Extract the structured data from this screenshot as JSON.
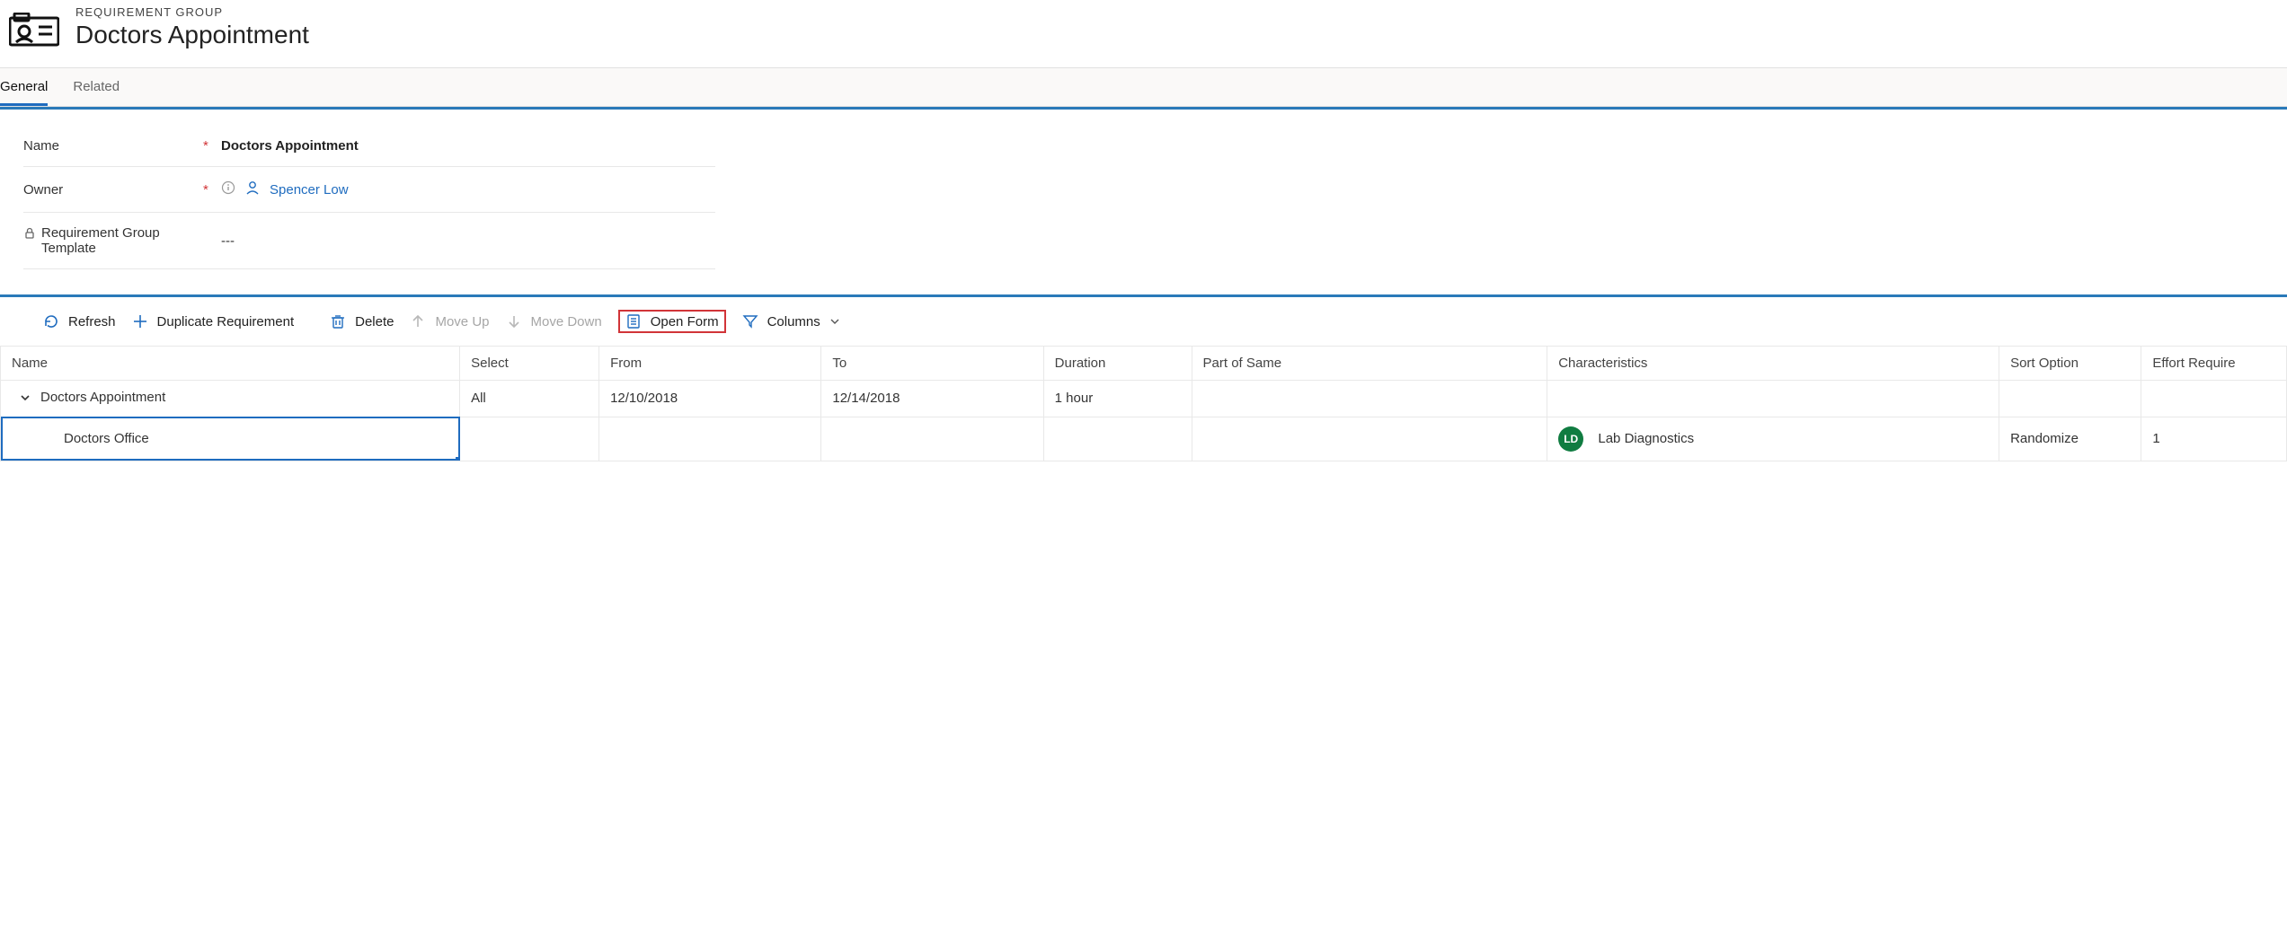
{
  "header": {
    "entity_type": "REQUIREMENT GROUP",
    "title": "Doctors Appointment"
  },
  "tabs": {
    "general": "General",
    "related": "Related"
  },
  "form": {
    "name_label": "Name",
    "name_value": "Doctors Appointment",
    "owner_label": "Owner",
    "owner_value": "Spencer Low",
    "template_label": "Requirement Group Template",
    "template_value": "---"
  },
  "toolbar": {
    "refresh": "Refresh",
    "duplicate": "Duplicate Requirement",
    "delete": "Delete",
    "move_up": "Move Up",
    "move_down": "Move Down",
    "open_form": "Open Form",
    "columns": "Columns"
  },
  "grid": {
    "headers": {
      "name": "Name",
      "select": "Select",
      "from": "From",
      "to": "To",
      "duration": "Duration",
      "part": "Part of Same",
      "characteristics": "Characteristics",
      "sort": "Sort Option",
      "effort": "Effort Require"
    },
    "rows": [
      {
        "name": "Doctors Appointment",
        "select": "All",
        "from": "12/10/2018",
        "to": "12/14/2018",
        "duration": "1 hour",
        "part": "",
        "characteristics": "",
        "char_badge": "",
        "sort": "",
        "effort": ""
      },
      {
        "name": "Doctors Office",
        "select": "",
        "from": "",
        "to": "",
        "duration": "",
        "part": "",
        "characteristics": "Lab Diagnostics",
        "char_badge": "LD",
        "sort": "Randomize",
        "effort": "1"
      }
    ]
  }
}
